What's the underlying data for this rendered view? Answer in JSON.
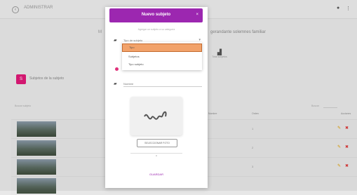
{
  "appbar": {
    "title": "ADMINISTRAR",
    "back_icon": "arrow-left-icon",
    "icons": [
      "notifications-icon",
      "more-vert-icon"
    ]
  },
  "background": {
    "heading_left": "M",
    "heading_right": "gerandante solemnes familiar",
    "stat_label": "Total subjetos",
    "section": {
      "badge": "S",
      "title": "Subjetos de la subjeto"
    },
    "table": {
      "search_label": "Buscar subjeto",
      "filter_label": "Buscar",
      "columns": [
        "Nombre",
        "Orden",
        "Acciones"
      ],
      "rows": [
        {
          "num": "1"
        },
        {
          "num": "2"
        },
        {
          "num": "3"
        }
      ]
    }
  },
  "modal": {
    "title": "Nuevo subjeto",
    "close_icon": "close-icon",
    "hint": "Agregar un subjeto a su categoría",
    "select_label": "Tipo de subjeto",
    "dropdown_options": [
      {
        "label": "Tipo"
      },
      {
        "label": "Subjetos"
      },
      {
        "label": "Tipo subjeto"
      }
    ],
    "name_label": "Nombre",
    "upload_button": "SELECCIONAR FOTO",
    "or_label": "o",
    "submit": "GUARDAR"
  },
  "colors": {
    "primary": "#9c27b0",
    "accent": "#e01a78",
    "highlight": "#f2a26a",
    "edit": "#e0a000",
    "delete": "#d33333"
  }
}
